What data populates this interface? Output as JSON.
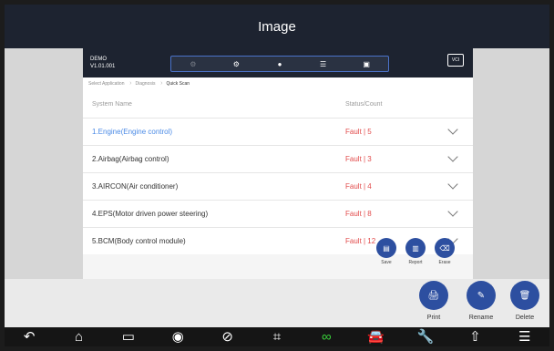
{
  "window": {
    "title": "Image"
  },
  "vehicle": {
    "name": "DEMO",
    "version": "V1.01.001"
  },
  "toolbar": {
    "tabs": [
      "",
      "",
      "",
      "",
      ""
    ]
  },
  "vci": {
    "label": "VCI"
  },
  "breadcrumbs": [
    "Select Application",
    "Diagnosis",
    "Quick Scan"
  ],
  "table": {
    "headers": {
      "system": "System Name",
      "status": "Status/Count"
    },
    "rows": [
      {
        "name": "1.Engine(Engine control)",
        "status": "Fault | 5"
      },
      {
        "name": "2.Airbag(Airbag control)",
        "status": "Fault | 3"
      },
      {
        "name": "3.AIRCON(Air conditioner)",
        "status": "Fault | 4"
      },
      {
        "name": "4.EPS(Motor driven power steering)",
        "status": "Fault | 8"
      },
      {
        "name": "5.BCM(Body control module)",
        "status": "Fault | 12"
      }
    ]
  },
  "small_actions": {
    "save": "Save",
    "report": "Report",
    "erase": "Erase"
  },
  "actions": {
    "print": "Print",
    "rename": "Rename",
    "delete": "Delete"
  },
  "dock": {
    "icons": [
      "back-icon",
      "home-icon",
      "recent-apps-icon",
      "camera-icon",
      "browser-icon",
      "crop-icon",
      "link-icon",
      "car-icon",
      "wrench-icon",
      "up-arrow-icon",
      "document-icon"
    ]
  }
}
